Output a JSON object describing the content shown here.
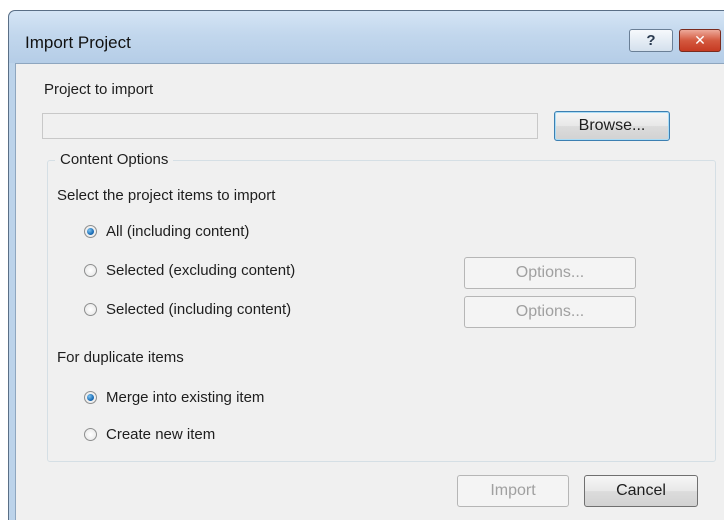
{
  "window": {
    "title": "Import Project",
    "help_glyph": "?",
    "close_glyph": "✕"
  },
  "project": {
    "label": "Project to import",
    "path_value": "",
    "browse_label": "Browse..."
  },
  "content_options": {
    "group_title": "Content Options",
    "prompt": "Select the project items to import",
    "options": [
      {
        "label": "All (including content)",
        "checked": true
      },
      {
        "label": "Selected (excluding content)",
        "checked": false,
        "options_button": "Options..."
      },
      {
        "label": "Selected (including content)",
        "checked": false,
        "options_button": "Options..."
      }
    ],
    "duplicate_prompt": "For duplicate items",
    "duplicate_options": [
      {
        "label": "Merge into existing item",
        "checked": true
      },
      {
        "label": "Create new item",
        "checked": false
      }
    ]
  },
  "footer": {
    "import_label": "Import",
    "cancel_label": "Cancel"
  },
  "colors": {
    "title_bar": "#c2d7ed",
    "client_background": "#f0f0f0",
    "close_button": "#c63a22",
    "radio_checked": "#1d6fb8"
  }
}
